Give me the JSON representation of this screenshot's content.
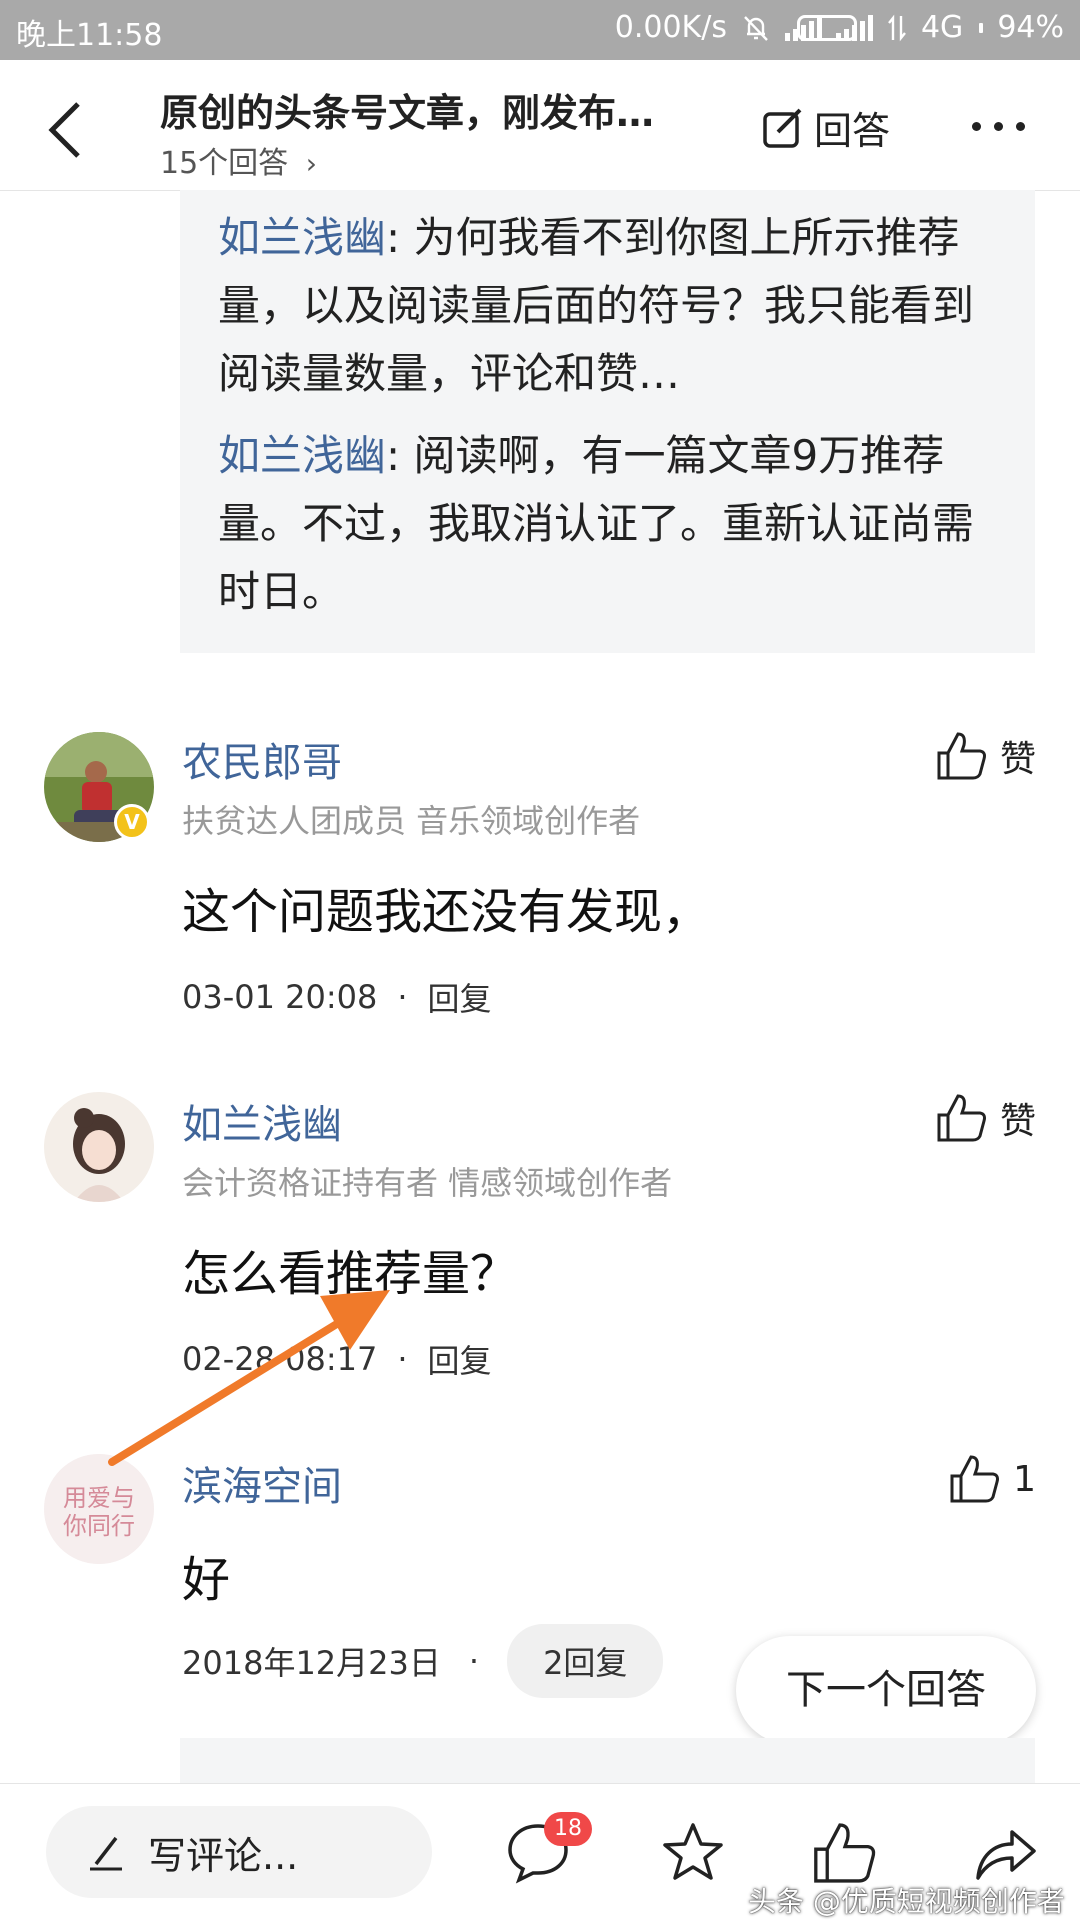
{
  "status_bar": {
    "time": "晚上11:58",
    "network_speed": "0.00K/s",
    "network_type": "4G",
    "battery_percent": "94%",
    "battery_level": 0.94,
    "battery_color": "#f0a220"
  },
  "header": {
    "title": "原创的头条号文章，刚发布…",
    "answers_count_label": "15个回答",
    "answer_button_label": "回答"
  },
  "quoted_replies": [
    {
      "user": "如兰浅幽",
      "text": ": 为何我看不到你图上所示推荐量，以及阅读量后面的符号？我只能看到阅读量数量，评论和赞…"
    },
    {
      "user": "如兰浅幽",
      "text": ": 阅读啊，有一篇文章9万推荐量。不过，我取消认证了。重新认证尚需时日。"
    }
  ],
  "comments": [
    {
      "username": "农民郎哥",
      "tagline": "扶贫达人团成员 音乐领域创作者",
      "body": "这个问题我还没有发现，",
      "time": "03-01 20:08",
      "reply_label": "回复",
      "like_label": "赞",
      "verified_badge": "V"
    },
    {
      "username": "如兰浅幽",
      "tagline": "会计资格证持有者 情感领域创作者",
      "body": "怎么看推荐量？",
      "time": "02-28 08:17",
      "reply_label": "回复",
      "like_label": "赞"
    },
    {
      "username": "滨海空间",
      "body": "好",
      "time": "2018年12月23日",
      "reply_count_label": "2回复",
      "like_count": "1",
      "avatar_text": "用爱与你同行"
    }
  ],
  "next_answer_label": "下一个回答",
  "bottom_bar": {
    "comment_placeholder": "写评论...",
    "comment_badge_count": "18"
  },
  "watermark": "头条 @优质短视频创作者",
  "colors": {
    "username_blue": "#406599",
    "annotation_arrow": "#f07a2a",
    "badge_red": "#f04848"
  }
}
